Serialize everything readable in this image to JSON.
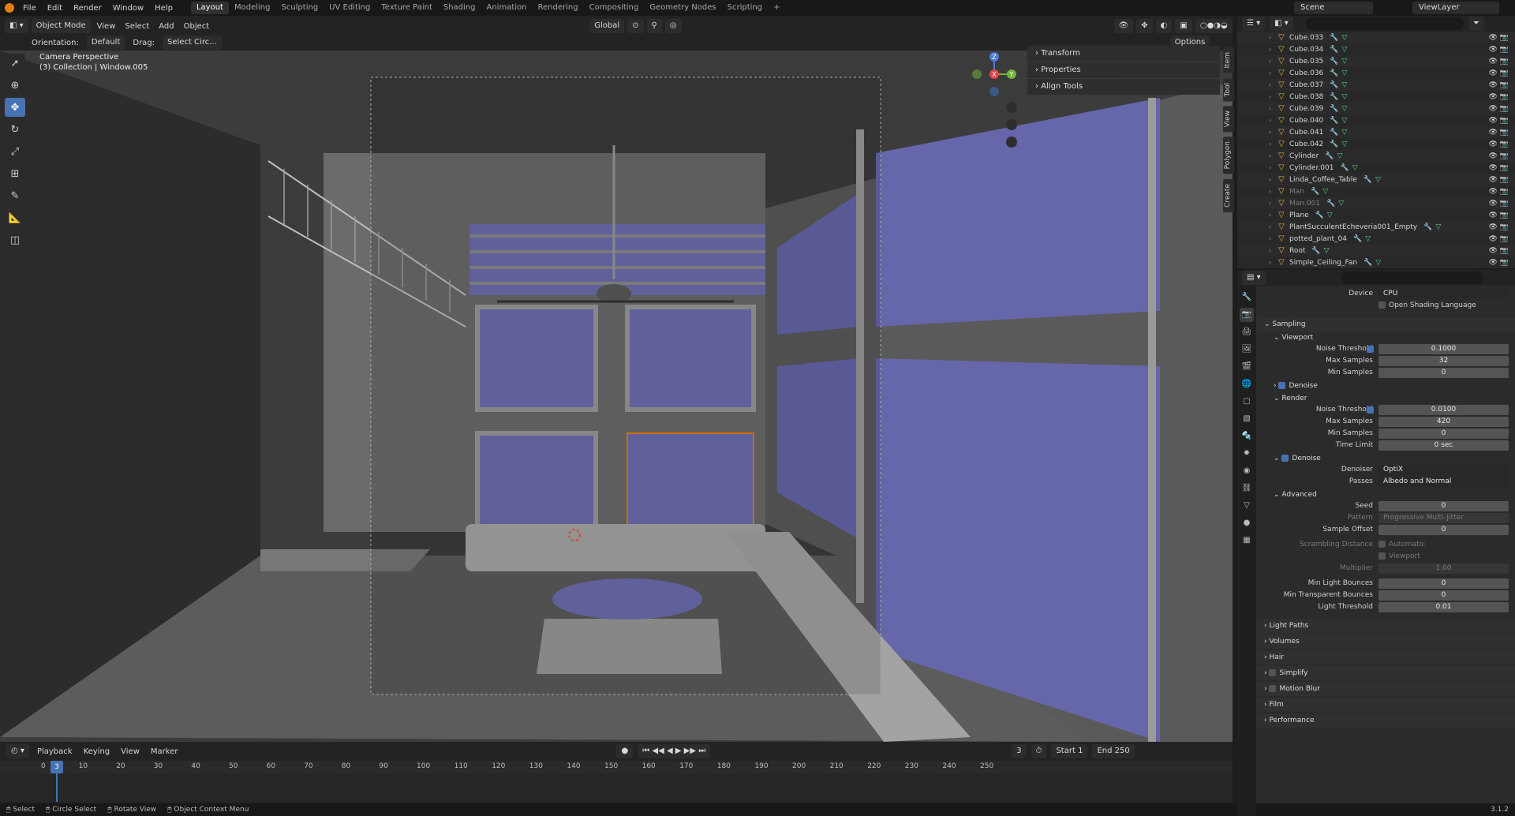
{
  "menus": [
    "File",
    "Edit",
    "Render",
    "Window",
    "Help"
  ],
  "workspaces": [
    "Layout",
    "Modeling",
    "Sculpting",
    "UV Editing",
    "Texture Paint",
    "Shading",
    "Animation",
    "Rendering",
    "Compositing",
    "Geometry Nodes",
    "Scripting",
    "+"
  ],
  "scene": {
    "label": "Scene",
    "view_layer": "ViewLayer"
  },
  "viewport_header": {
    "mode": "Object Mode",
    "menus": [
      "View",
      "Select",
      "Add",
      "Object"
    ],
    "transform": "Global",
    "options": "Options"
  },
  "viewport_header2": {
    "orientation_label": "Orientation:",
    "orientation": "Default",
    "drag_label": "Drag:",
    "drag": "Select Circ..."
  },
  "viewport": {
    "camera": "Camera Perspective",
    "collection": "(3) Collection | Window.005"
  },
  "npanel": {
    "items": [
      "Transform",
      "Properties",
      "Align Tools"
    ],
    "tabs": [
      "Item",
      "Tool",
      "View",
      "Polygon",
      "Create"
    ]
  },
  "gizmo": {
    "x": "X",
    "y": "Y",
    "z": "Z"
  },
  "outliner": [
    {
      "name": "Cube.033",
      "dim": false
    },
    {
      "name": "Cube.034",
      "dim": false
    },
    {
      "name": "Cube.035",
      "dim": false
    },
    {
      "name": "Cube.036",
      "dim": false
    },
    {
      "name": "Cube.037",
      "dim": false
    },
    {
      "name": "Cube.038",
      "dim": false
    },
    {
      "name": "Cube.039",
      "dim": false
    },
    {
      "name": "Cube.040",
      "dim": false
    },
    {
      "name": "Cube.041",
      "dim": false
    },
    {
      "name": "Cube.042",
      "dim": false
    },
    {
      "name": "Cylinder",
      "dim": false
    },
    {
      "name": "Cylinder.001",
      "dim": false
    },
    {
      "name": "Linda_Coffee_Table",
      "dim": false
    },
    {
      "name": "Man",
      "dim": true
    },
    {
      "name": "Man.001",
      "dim": true
    },
    {
      "name": "Plane",
      "dim": false
    },
    {
      "name": "PlantSucculentEcheveria001_Empty",
      "dim": false
    },
    {
      "name": "potted_plant_04",
      "dim": false
    },
    {
      "name": "Root",
      "dim": false
    },
    {
      "name": "Simple_Ceiling_Fan",
      "dim": false
    }
  ],
  "properties": {
    "device_label": "Device",
    "device": "CPU",
    "osl": "Open Shading Language",
    "sampling": "Sampling",
    "viewport": "Viewport",
    "render": "Render",
    "noise_threshold_label": "Noise Threshold",
    "max_samples_label": "Max Samples",
    "min_samples_label": "Min Samples",
    "time_limit_label": "Time Limit",
    "vp_noise": "0.1000",
    "vp_max": "32",
    "vp_min": "0",
    "denoise": "Denoise",
    "r_noise": "0.0100",
    "r_max": "420",
    "r_min": "0",
    "r_time": "0 sec",
    "denoiser_label": "Denoiser",
    "denoiser": "OptiX",
    "passes_label": "Passes",
    "passes": "Albedo and Normal",
    "advanced": "Advanced",
    "seed_label": "Seed",
    "seed": "0",
    "pattern_label": "Pattern",
    "pattern": "Progressive Multi-Jitter",
    "sample_offset_label": "Sample Offset",
    "sample_offset": "0",
    "scrambling_label": "Scrambling Distance",
    "automatic": "Automatic",
    "viewport_chk": "Viewport",
    "multiplier_label": "Multiplier",
    "multiplier": "1.00",
    "min_light_label": "Min Light Bounces",
    "min_light": "0",
    "min_trans_label": "Min Transparent Bounces",
    "min_trans": "0",
    "light_thresh_label": "Light Threshold",
    "light_thresh": "0.01",
    "sections": [
      "Light Paths",
      "Volumes",
      "Hair",
      "Simplify",
      "Motion Blur",
      "Film",
      "Performance"
    ]
  },
  "timeline": {
    "menus": [
      "Playback",
      "Keying",
      "View",
      "Marker"
    ],
    "current": "3",
    "start_label": "Start",
    "start": "1",
    "end_label": "End",
    "end": "250",
    "ticks": [
      "0",
      "10",
      "20",
      "30",
      "40",
      "50",
      "60",
      "70",
      "80",
      "90",
      "100",
      "110",
      "120",
      "130",
      "140",
      "150",
      "160",
      "170",
      "180",
      "190",
      "200",
      "210",
      "220",
      "230",
      "240",
      "250"
    ]
  },
  "status": {
    "select": "Select",
    "circle": "Circle Select",
    "rotate": "Rotate View",
    "context": "Object Context Menu",
    "version": "3.1.2"
  },
  "colors": {
    "accent": "#4772b3",
    "window_glass": "#6f6fb0",
    "orange": "#e87d0d"
  }
}
